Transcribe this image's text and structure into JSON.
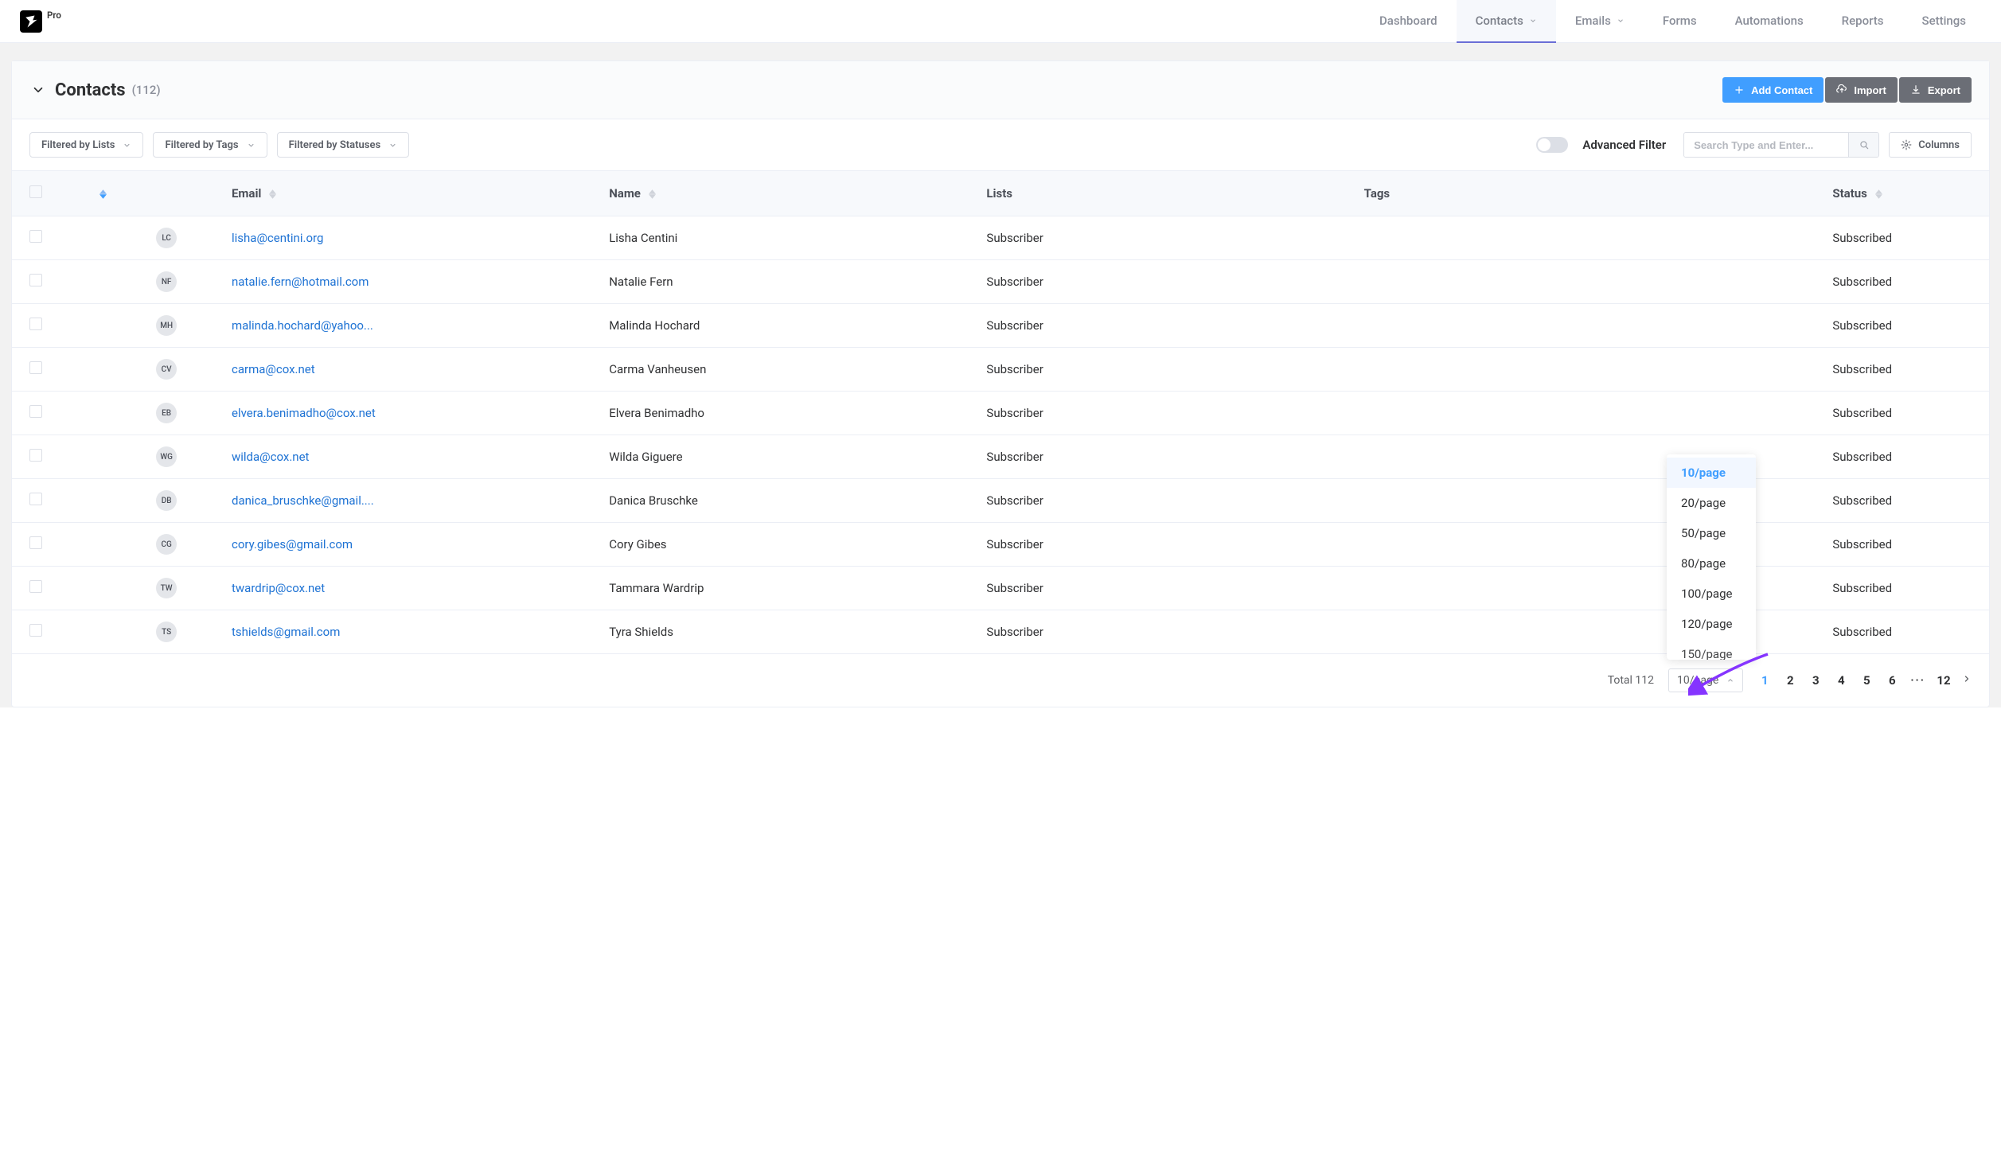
{
  "logo_badge": "Pro",
  "nav": {
    "items": [
      {
        "label": "Dashboard",
        "dropdown": false,
        "active": false
      },
      {
        "label": "Contacts",
        "dropdown": true,
        "active": true
      },
      {
        "label": "Emails",
        "dropdown": true,
        "active": false
      },
      {
        "label": "Forms",
        "dropdown": false,
        "active": false
      },
      {
        "label": "Automations",
        "dropdown": false,
        "active": false
      },
      {
        "label": "Reports",
        "dropdown": false,
        "active": false
      },
      {
        "label": "Settings",
        "dropdown": false,
        "active": false
      }
    ]
  },
  "header": {
    "title": "Contacts",
    "count_display": "(112)",
    "add_contact": "Add Contact",
    "import": "Import",
    "export": "Export"
  },
  "filters": {
    "lists": "Filtered by Lists",
    "tags": "Filtered by Tags",
    "statuses": "Filtered by Statuses",
    "advanced": "Advanced Filter",
    "search_placeholder": "Search Type and Enter...",
    "columns": "Columns"
  },
  "columns": {
    "email": "Email",
    "name": "Name",
    "lists": "Lists",
    "tags": "Tags",
    "status": "Status"
  },
  "rows": [
    {
      "initials": "LC",
      "email": "lisha@centini.org",
      "name": "Lisha Centini",
      "lists": "Subscriber",
      "tags": "",
      "status": "Subscribed"
    },
    {
      "initials": "NF",
      "email": "natalie.fern@hotmail.com",
      "name": "Natalie Fern",
      "lists": "Subscriber",
      "tags": "",
      "status": "Subscribed"
    },
    {
      "initials": "MH",
      "email": "malinda.hochard@yahoo...",
      "name": "Malinda Hochard",
      "lists": "Subscriber",
      "tags": "",
      "status": "Subscribed"
    },
    {
      "initials": "CV",
      "email": "carma@cox.net",
      "name": "Carma Vanheusen",
      "lists": "Subscriber",
      "tags": "",
      "status": "Subscribed"
    },
    {
      "initials": "EB",
      "email": "elvera.benimadho@cox.net",
      "name": "Elvera Benimadho",
      "lists": "Subscriber",
      "tags": "",
      "status": "Subscribed"
    },
    {
      "initials": "WG",
      "email": "wilda@cox.net",
      "name": "Wilda Giguere",
      "lists": "Subscriber",
      "tags": "",
      "status": "Subscribed"
    },
    {
      "initials": "DB",
      "email": "danica_bruschke@gmail....",
      "name": "Danica Bruschke",
      "lists": "Subscriber",
      "tags": "",
      "status": "Subscribed"
    },
    {
      "initials": "CG",
      "email": "cory.gibes@gmail.com",
      "name": "Cory Gibes",
      "lists": "Subscriber",
      "tags": "",
      "status": "Subscribed"
    },
    {
      "initials": "TW",
      "email": "twardrip@cox.net",
      "name": "Tammara Wardrip",
      "lists": "Subscriber",
      "tags": "",
      "status": "Subscribed"
    },
    {
      "initials": "TS",
      "email": "tshields@gmail.com",
      "name": "Tyra Shields",
      "lists": "Subscriber",
      "tags": "",
      "status": "Subscribed"
    }
  ],
  "pagination": {
    "total_label": "Total 112",
    "size_display": "10/page",
    "size_options": [
      {
        "label": "10/page",
        "selected": true
      },
      {
        "label": "20/page",
        "selected": false
      },
      {
        "label": "50/page",
        "selected": false
      },
      {
        "label": "80/page",
        "selected": false
      },
      {
        "label": "100/page",
        "selected": false
      },
      {
        "label": "120/page",
        "selected": false
      },
      {
        "label": "150/page",
        "selected": false
      }
    ],
    "pages": [
      "1",
      "2",
      "3",
      "4",
      "5",
      "6"
    ],
    "ellipsis": "···",
    "last_page": "12",
    "active_page": "1"
  },
  "colors": {
    "primary": "#409eff",
    "link": "#1f73d4",
    "danger_accent": "#8534ff"
  }
}
